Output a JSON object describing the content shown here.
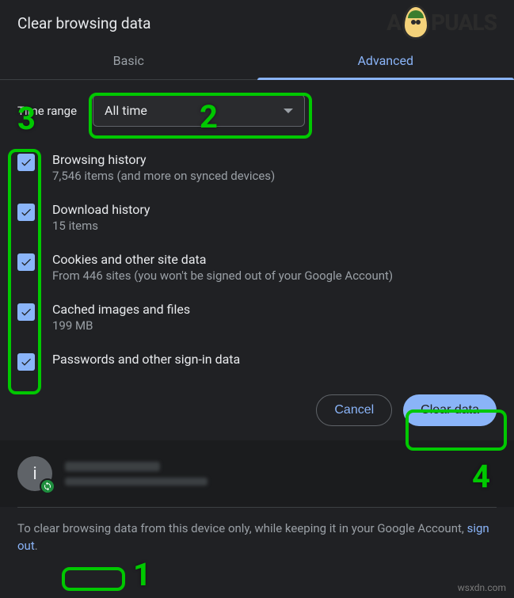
{
  "dialog": {
    "title": "Clear browsing data"
  },
  "tabs": {
    "basic": "Basic",
    "advanced": "Advanced"
  },
  "time": {
    "label": "Time range",
    "value": "All time"
  },
  "options": [
    {
      "title": "Browsing history",
      "sub": "7,546 items (and more on synced devices)",
      "checked": true
    },
    {
      "title": "Download history",
      "sub": "15 items",
      "checked": true
    },
    {
      "title": "Cookies and other site data",
      "sub": "From 446 sites (you won't be signed out of your Google Account)",
      "checked": true
    },
    {
      "title": "Cached images and files",
      "sub": "199 MB",
      "checked": true
    },
    {
      "title": "Passwords and other sign-in data",
      "sub": "",
      "checked": true
    }
  ],
  "buttons": {
    "cancel": "Cancel",
    "clear": "Clear data"
  },
  "account": {
    "initial": "i"
  },
  "footer": {
    "pre": "To clear browsing data from this device only, while keeping it in your Google Account, ",
    "link": "sign out",
    "post": "."
  },
  "annotations": {
    "n1": "1",
    "n2": "2",
    "n3": "3",
    "n4": "4"
  },
  "watermark": {
    "brand_pre": "A",
    "brand_post": "PUALS",
    "url": "wsxdn.com"
  }
}
